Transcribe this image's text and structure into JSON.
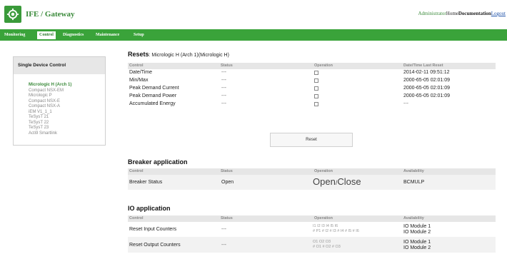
{
  "header": {
    "title": "IFE / Gateway",
    "links": {
      "admin": "Administrator",
      "home": "Home",
      "documentation": "Documentation",
      "logout": "Logout"
    }
  },
  "nav": {
    "tabs": [
      "Monitoring",
      "Control",
      "Diagnostics",
      "Maintenance",
      "Setup"
    ],
    "active": "Control"
  },
  "sidebar": {
    "title": "Single Device Control",
    "items": [
      "Micrologic H (Arch 1)",
      "Compact NSX-EM",
      "Micrologic P",
      "Compact NSX-E",
      "Compact NSX-A",
      "iEM V1_1_1",
      "TeSysT 21",
      "TeSysT 22",
      "TeSysT 23",
      "Acti9 Smartlink"
    ]
  },
  "resets": {
    "title": "Resets",
    "subtitle": ": Micrologic H (Arch 1)(Micrologic H)",
    "columns": [
      "Control",
      "Status",
      "Operation",
      "Date/Time Last Reset"
    ],
    "rows": [
      {
        "control": "Date/Time",
        "status": "---",
        "date": "2014-02-11 09:51:12"
      },
      {
        "control": "Min/Max",
        "status": "---",
        "date": "2000-65-05 02:01:09"
      },
      {
        "control": "Peak Demand Current",
        "status": "---",
        "date": "2000-65-05 02:01:09"
      },
      {
        "control": "Peak Demand Power",
        "status": "---",
        "date": "2000-65-05 02:01:09"
      },
      {
        "control": "Accumulated Energy",
        "status": "---",
        "date": "---"
      }
    ],
    "button": "Reset"
  },
  "breaker": {
    "title": "Breaker application",
    "columns": [
      "Control",
      "Status",
      "Operation",
      "Availability"
    ],
    "row": {
      "control": "Breaker Status",
      "status": "Open",
      "op_open": "Open",
      "op_sep": "/",
      "op_close": "Close",
      "availability": "BCMULP"
    }
  },
  "io": {
    "title": "IO application",
    "columns": [
      "Control",
      "Status",
      "Operation",
      "Availability"
    ],
    "rows": [
      {
        "control": "Reset Input Counters",
        "status": "---",
        "op_line1": "I1  I2  I3  I4  I5  I6",
        "op_line2": "# P1  # I2  # I3  # I4  # I5  # I6",
        "avail1": "IO Module 1",
        "avail2": "IO Module 2"
      },
      {
        "control": "Reset Output Counters",
        "status": "---",
        "op_line1": "O1  O2  O3",
        "op_line2": "# O1  # O2  # O3",
        "avail1": "IO Module 1",
        "avail2": "IO Module 2"
      }
    ]
  },
  "colors": {
    "brand_green": "#3aa33a",
    "header_row": "#e6e6e6"
  }
}
